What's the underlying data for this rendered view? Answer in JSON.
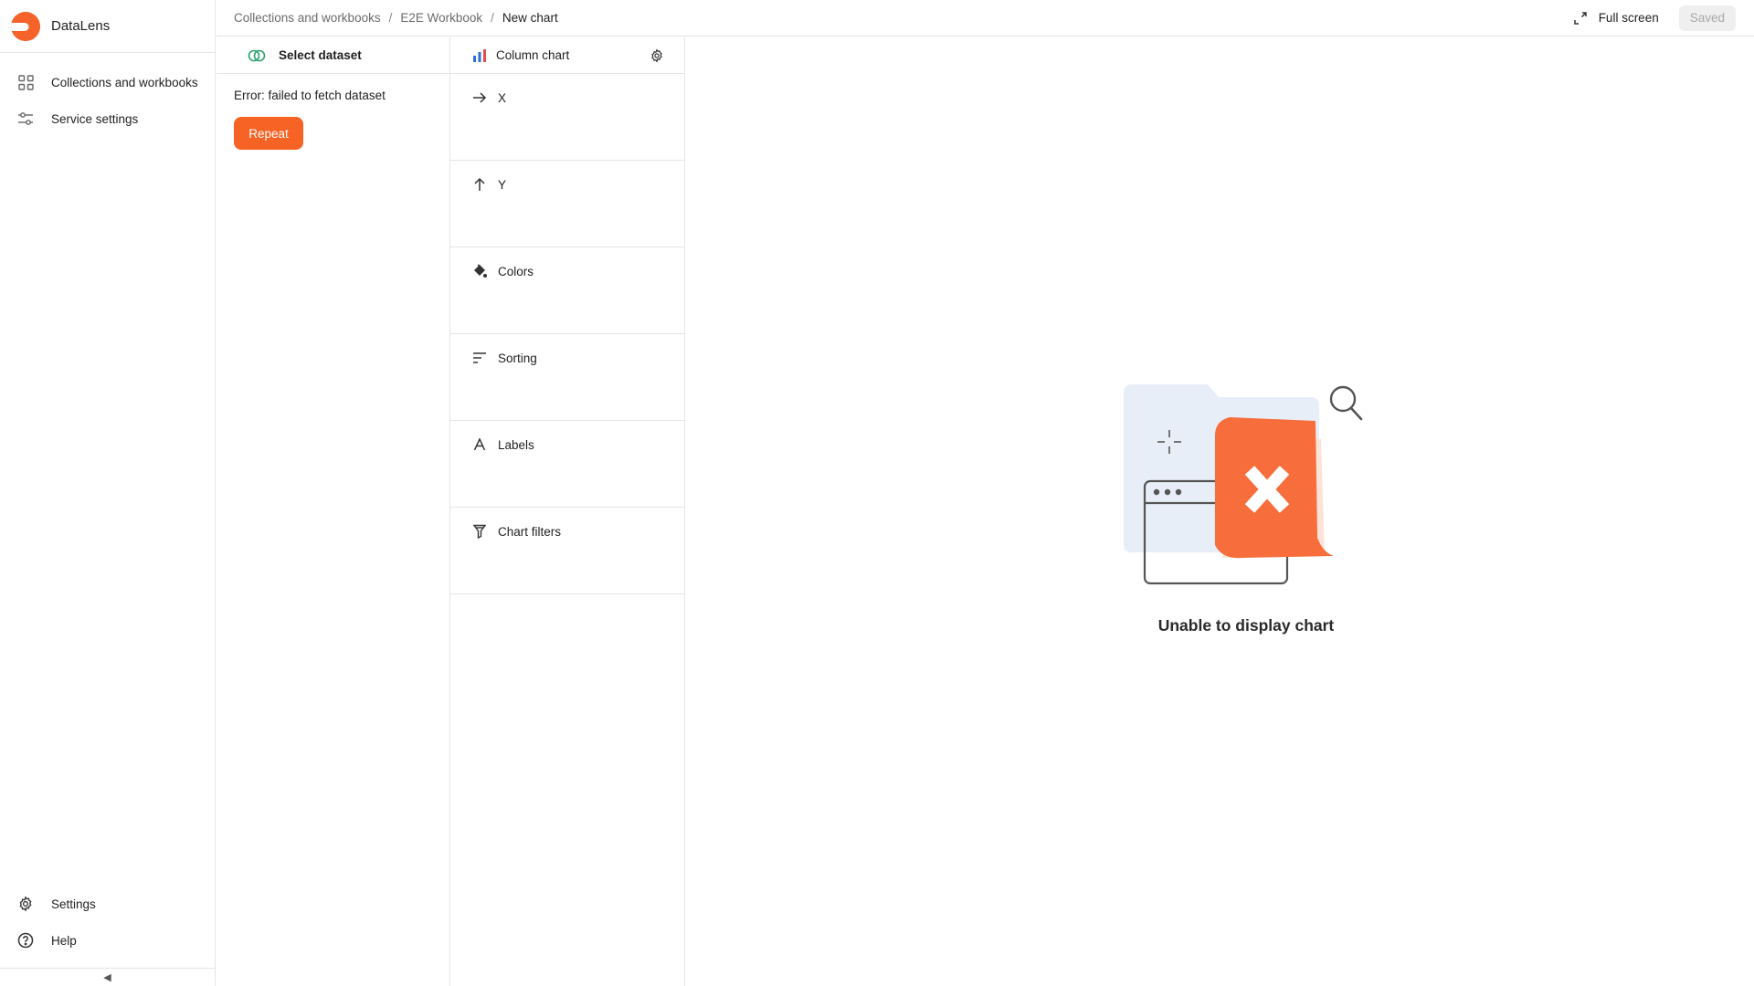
{
  "app": {
    "name": "DataLens"
  },
  "nav": {
    "top": [
      {
        "label": "Collections and workbooks",
        "icon": "grid-icon"
      },
      {
        "label": "Service settings",
        "icon": "sliders-icon"
      }
    ],
    "bottom": [
      {
        "label": "Settings",
        "icon": "gear-icon"
      },
      {
        "label": "Help",
        "icon": "help-circle-icon"
      }
    ],
    "collapse_glyph": "◀"
  },
  "breadcrumbs": {
    "items": [
      "Collections and workbooks",
      "E2E Workbook",
      "New chart"
    ],
    "separator": "/"
  },
  "header": {
    "fullscreen_label": "Full screen",
    "saved_label": "Saved"
  },
  "dataset": {
    "select_label": "Select dataset",
    "error_text": "Error: failed to fetch dataset",
    "repeat_label": "Repeat"
  },
  "visualization": {
    "type_label": "Column chart",
    "sections": [
      {
        "label": "X",
        "icon": "arrow-right-icon"
      },
      {
        "label": "Y",
        "icon": "arrow-up-icon"
      },
      {
        "label": "Colors",
        "icon": "paint-bucket-icon"
      },
      {
        "label": "Sorting",
        "icon": "sort-lines-icon"
      },
      {
        "label": "Labels",
        "icon": "letter-a-icon"
      },
      {
        "label": "Chart filters",
        "icon": "funnel-icon"
      }
    ]
  },
  "chart": {
    "error_title": "Unable to display chart"
  },
  "colors": {
    "accent": "#f76324",
    "illustration_bg": "#e8eef8",
    "text": "#1f1f1f",
    "muted": "#6b6b6b"
  }
}
